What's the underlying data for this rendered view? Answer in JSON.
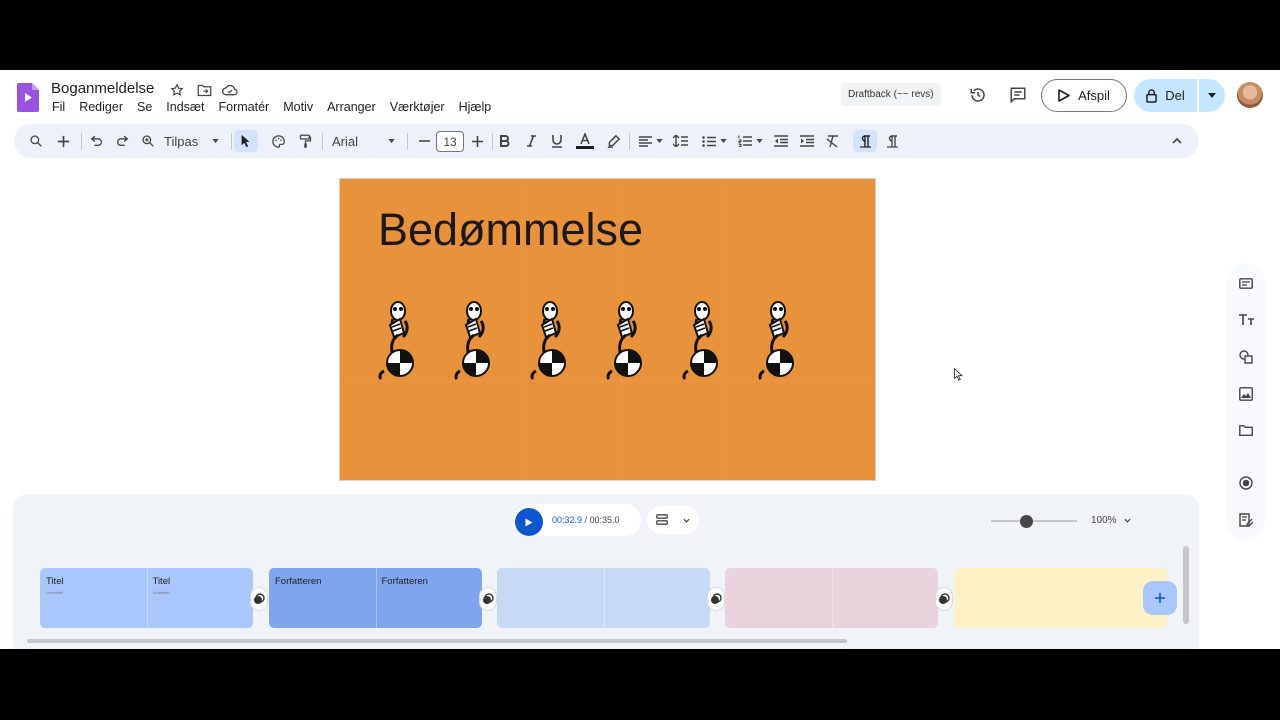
{
  "header": {
    "doc_title": "Boganmeldelse",
    "draftback": "Draftback (~~ revs)",
    "play_label": "Afspil",
    "share_label": "Del"
  },
  "menu": [
    "Fil",
    "Rediger",
    "Se",
    "Indsæt",
    "Formatér",
    "Motiv",
    "Arranger",
    "Værktøjer",
    "Hjælp"
  ],
  "toolbar": {
    "zoom_label": "Tilpas",
    "font_name": "Arial",
    "font_size": "13"
  },
  "slide": {
    "title": "Bedømmelse",
    "background": "#e8923b",
    "reader_count": 6
  },
  "timeline": {
    "current_time": "00:32.9",
    "total_time": " / 00:35.0",
    "zoom": "100%",
    "clips": [
      {
        "labels": [
          "Titel",
          "Titel"
        ],
        "subs": [
          "Undertitel",
          "Undertitel"
        ],
        "color": "#a8c7fa"
      },
      {
        "labels": [
          "Forfatteren",
          "Forfatteren"
        ],
        "subs": [
          "",
          ""
        ],
        "color": "#7fa6ec"
      },
      {
        "labels": [
          "",
          ""
        ],
        "subs": [
          "",
          ""
        ],
        "color": "#c6d9f7"
      },
      {
        "labels": [
          "",
          ""
        ],
        "subs": [
          "",
          ""
        ],
        "color": "#ead3dd"
      },
      {
        "labels": [
          "",
          ""
        ],
        "subs": [
          "",
          ""
        ],
        "color": "#fef1c6"
      }
    ]
  },
  "colors": {
    "accent": "#0b57d0",
    "share_bg": "#c2e7ff",
    "toolbar_bg": "#edf2fa"
  }
}
